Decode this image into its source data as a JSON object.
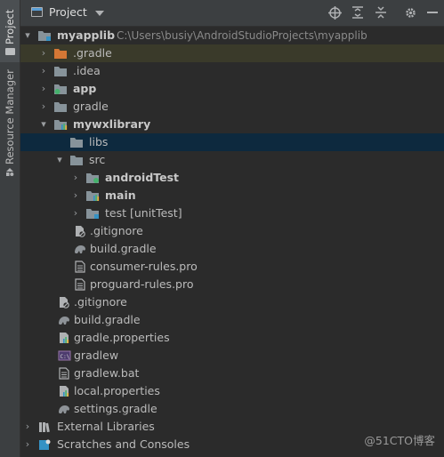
{
  "side_tabs": {
    "project": "Project",
    "resource_manager": "Resource Manager"
  },
  "header": {
    "title": "Project"
  },
  "tree": {
    "root": {
      "name": "myapplib",
      "path": "C:\\Users\\busiy\\AndroidStudioProjects\\myapplib"
    },
    "gradle_dir": ".gradle",
    "idea_dir": ".idea",
    "app": "app",
    "gradle_folder": "gradle",
    "mywxlibrary": "mywxlibrary",
    "libs": "libs",
    "src": "src",
    "androidTest": "androidTest",
    "main": "main",
    "test": "test [unitTest]",
    "lib_gitignore": ".gitignore",
    "lib_build_gradle": "build.gradle",
    "consumer_rules": "consumer-rules.pro",
    "proguard_rules": "proguard-rules.pro",
    "root_gitignore": ".gitignore",
    "root_build_gradle": "build.gradle",
    "gradle_properties": "gradle.properties",
    "gradlew": "gradlew",
    "gradlew_bat": "gradlew.bat",
    "local_properties": "local.properties",
    "settings_gradle": "settings.gradle",
    "external_libraries": "External Libraries",
    "scratches": "Scratches and Consoles"
  },
  "watermark": "@51CTO博客",
  "colors": {
    "background": "#2b2b2b",
    "selection": "#0d293e",
    "folder": "#87939a",
    "module_dot": "#45b26c",
    "excluded_folder": "#d47735"
  }
}
